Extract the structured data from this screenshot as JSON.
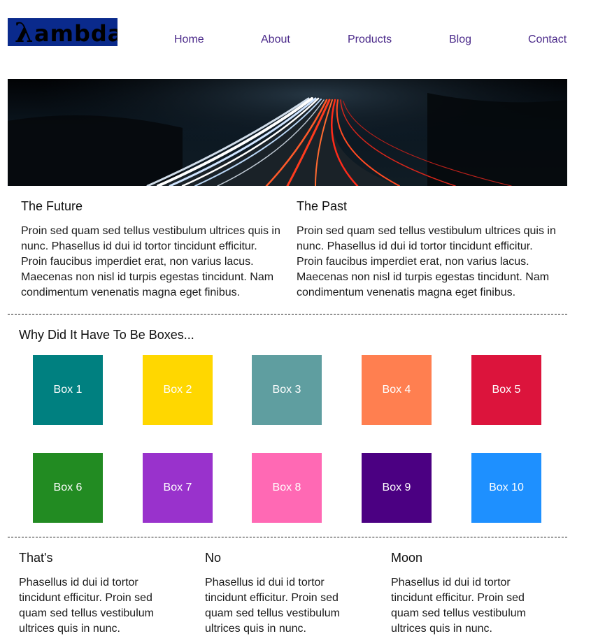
{
  "header": {
    "logo_text": "ambda",
    "logo_symbol": "λ",
    "nav": [
      "Home",
      "About",
      "Products",
      "Blog",
      "Contact"
    ]
  },
  "hero": {
    "image": "long-exposure highway light trails at night"
  },
  "top_section": [
    {
      "title": "The Future",
      "text": "Proin sed quam sed tellus vestibulum ultrices quis in nunc. Phasellus id dui id tortor tincidunt efficitur. Proin faucibus imperdiet erat, non varius lacus. Maecenas non nisl id turpis egestas tincidunt. Nam condimentum venenatis magna eget finibus."
    },
    {
      "title": "The Past",
      "text": "Proin sed quam sed tellus vestibulum ultrices quis in nunc. Phasellus id dui id tortor tincidunt efficitur. Proin faucibus imperdiet erat, non varius lacus. Maecenas non nisl id turpis egestas tincidunt. Nam condimentum venenatis magna eget finibus."
    }
  ],
  "boxes_section": {
    "title": "Why Did It Have To Be Boxes...",
    "boxes": [
      {
        "label": "Box 1",
        "color": "#008080"
      },
      {
        "label": "Box 2",
        "color": "#ffd700"
      },
      {
        "label": "Box 3",
        "color": "#5f9ea0"
      },
      {
        "label": "Box 4",
        "color": "#ff7f50"
      },
      {
        "label": "Box 5",
        "color": "#dc143c"
      },
      {
        "label": "Box 6",
        "color": "#228b22"
      },
      {
        "label": "Box 7",
        "color": "#9932cc"
      },
      {
        "label": "Box 8",
        "color": "#ff69b4"
      },
      {
        "label": "Box 9",
        "color": "#4b0082"
      },
      {
        "label": "Box 10",
        "color": "#1e90ff"
      }
    ]
  },
  "bottom_section": [
    {
      "title": "That's",
      "text": "Phasellus id dui id tortor tincidunt efficitur. Proin sed quam sed tellus vestibulum ultrices quis in nunc."
    },
    {
      "title": "No",
      "text": "Phasellus id dui id tortor tincidunt efficitur. Proin sed quam sed tellus vestibulum ultrices quis in nunc."
    },
    {
      "title": "Moon",
      "text": "Phasellus id dui id tortor tincidunt efficitur. Proin sed quam sed tellus vestibulum ultrices quis in nunc."
    }
  ]
}
